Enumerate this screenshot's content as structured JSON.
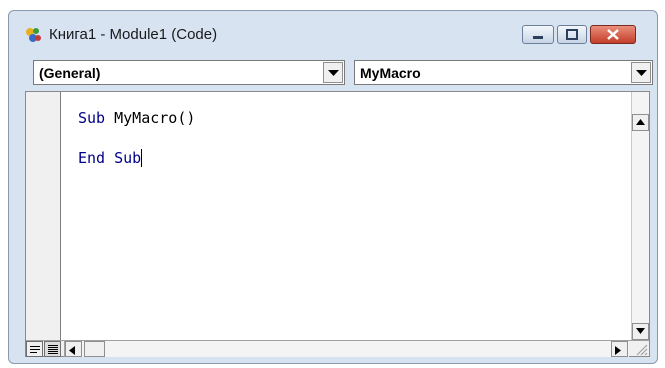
{
  "window": {
    "title": "Книга1 - Module1 (Code)",
    "icon": "vba-module-icon"
  },
  "title_buttons": [
    "minimize-icon",
    "maximize-icon",
    "close-icon"
  ],
  "object_combo": {
    "value": "(General)"
  },
  "procedure_combo": {
    "value": "MyMacro"
  },
  "code": {
    "line1_keyword": "Sub",
    "line1_rest": " MyMacro()",
    "line2_keyword": "End",
    "line2_rest": " Sub"
  },
  "colors": {
    "keyword": "#00008b",
    "window_frame": "#d7e3f1",
    "close_button": "#c33e2a"
  }
}
